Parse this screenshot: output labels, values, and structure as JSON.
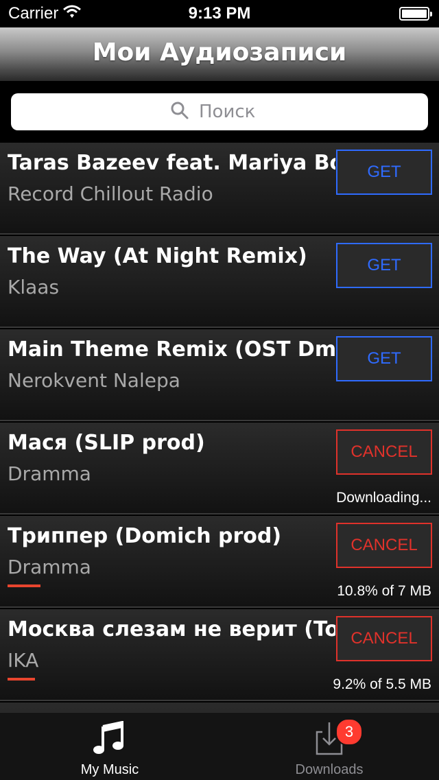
{
  "status_bar": {
    "carrier": "Carrier",
    "time": "9:13 PM"
  },
  "nav": {
    "title": "Мои Аудиозаписи"
  },
  "search": {
    "placeholder": "Поиск",
    "value": ""
  },
  "tracks": [
    {
      "title": "Taras Bazeev feat. Mariya Bona",
      "artist": "Record Chillout Radio",
      "button": "GET",
      "state": "idle",
      "status": "",
      "progress": null
    },
    {
      "title": "The Way (At Night Remix)",
      "artist": "Klaas",
      "button": "GET",
      "state": "idle",
      "status": "",
      "progress": null
    },
    {
      "title": "Main Theme Remix (OST DmC)",
      "artist": "Nerokvent Nalepa",
      "button": "GET",
      "state": "idle",
      "status": "",
      "progress": null
    },
    {
      "title": "Мася (SLIP prod)",
      "artist": "Dramma",
      "button": "CANCEL",
      "state": "downloading",
      "status": "Downloading...",
      "progress": null
    },
    {
      "title": "Триппер (Domich prod)",
      "artist": "Dramma",
      "button": "CANCEL",
      "state": "downloading",
      "status": "10.8% of 7 MB",
      "progress": 0.108
    },
    {
      "title": "Москва слезам не верит (Tom",
      "artist": "IKA",
      "button": "CANCEL",
      "state": "downloading",
      "status": "9.2% of 5.5 MB",
      "progress": 0.092
    },
    {
      "title": "",
      "artist": "",
      "button": "",
      "state": "idle",
      "status": "",
      "progress": null
    }
  ],
  "tabs": [
    {
      "label": "My Music",
      "icon": "music-note-icon",
      "selected": true
    },
    {
      "label": "Downloads",
      "icon": "download-tray-icon",
      "selected": false,
      "badge": "3"
    }
  ],
  "colors": {
    "get": "#2f6bff",
    "cancel": "#e0322b",
    "progress": "#e8452e",
    "tab_selected": "#ffffff",
    "tab_unselected": "#8e8e93",
    "badge": "#ff3b30"
  }
}
